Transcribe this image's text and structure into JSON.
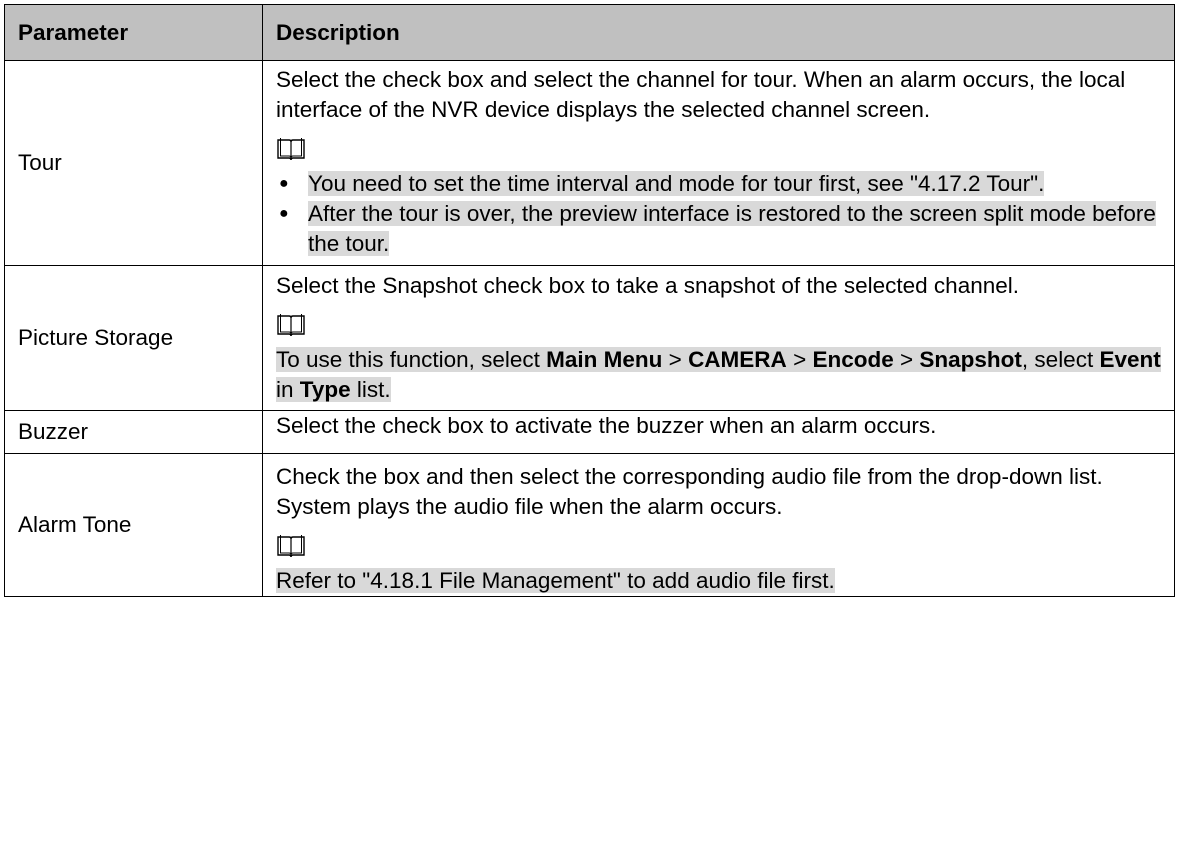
{
  "table": {
    "headers": {
      "parameter": "Parameter",
      "description": "Description"
    },
    "rows": [
      {
        "parameter": "Tour",
        "description": "Select the check box and select the channel for tour. When an alarm occurs, the local interface of the NVR device displays the selected channel screen.",
        "note_bullets": [
          "You need to set the time interval and mode for tour first, see \"4.17.2 Tour\".",
          "After the tour is over, the preview interface is restored to the screen split mode before the tour."
        ]
      },
      {
        "parameter": "Picture Storage",
        "description": "Select the Snapshot check box to take a snapshot of the selected channel.",
        "note": {
          "t1": "To use this function, select ",
          "b1": "Main Menu",
          "t2": " > ",
          "b2": "CAMERA",
          "t3": " > ",
          "b3": "Encode",
          "t4": " > ",
          "b4": "Snapshot",
          "t5": ", select ",
          "b5": "Event",
          "t6": " in ",
          "b6": "Type",
          "t7": " list."
        }
      },
      {
        "parameter": "Buzzer",
        "description": "Select the check box to activate the buzzer when an alarm occurs."
      },
      {
        "parameter": "Alarm Tone",
        "description": "Check the box and then select the corresponding audio file from the drop-down list. System plays the audio file when the alarm occurs.",
        "note_text": "Refer to \"4.18.1 File Management\" to add audio file first."
      }
    ]
  },
  "icons": {
    "note": "open-book-note-icon"
  },
  "colors": {
    "header_bg": "#c0c0c0",
    "highlight_bg": "#d9d9d9",
    "border": "#000000"
  }
}
